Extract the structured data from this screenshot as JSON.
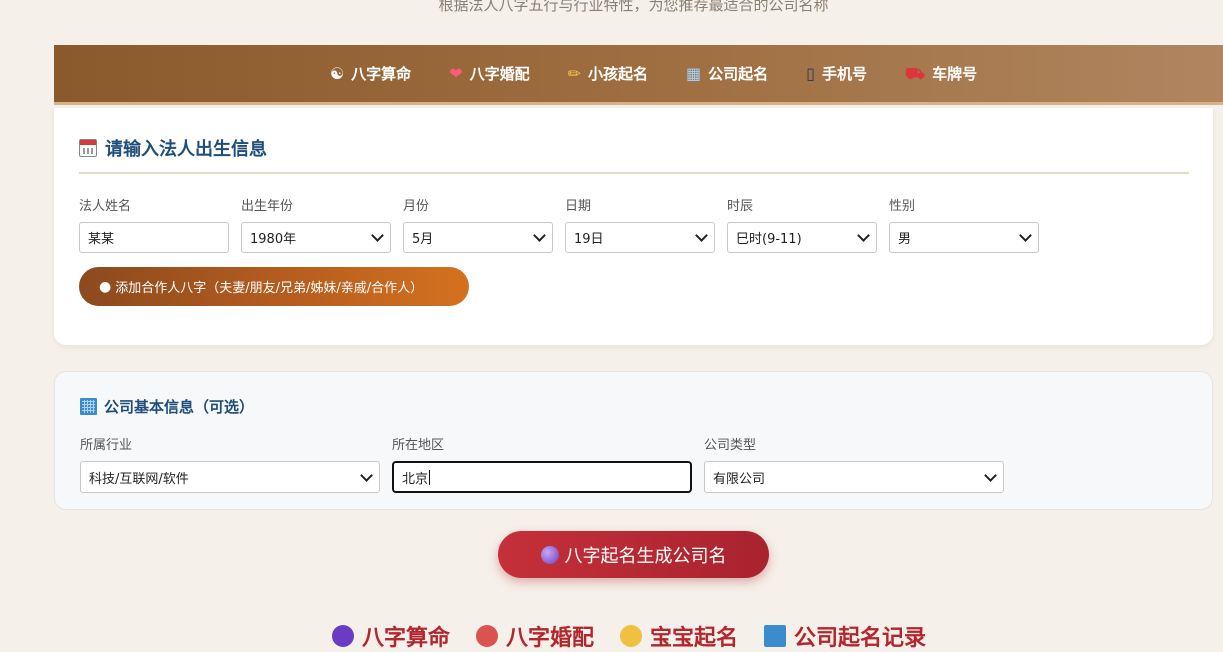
{
  "header": {
    "subtitle": "根据法人八字五行与行业特性，为您推荐最适合的公司名称"
  },
  "nav": {
    "items": [
      {
        "icon": "yin-yang-icon",
        "glyph": "☯",
        "label": "八字算命"
      },
      {
        "icon": "heart-icon",
        "glyph": "❤",
        "label": "八字婚配"
      },
      {
        "icon": "pencil-icon",
        "glyph": "✏",
        "label": "小孩起名"
      },
      {
        "icon": "building-icon",
        "glyph": "▦",
        "label": "公司起名"
      },
      {
        "icon": "phone-icon",
        "glyph": "▯",
        "label": "手机号"
      },
      {
        "icon": "car-icon",
        "glyph": "⛟",
        "label": "车牌号"
      }
    ]
  },
  "birth_form": {
    "title": "请输入法人出生信息",
    "fields": {
      "name": {
        "label": "法人姓名",
        "value": "某某"
      },
      "year": {
        "label": "出生年份",
        "value": "1980年"
      },
      "month": {
        "label": "月份",
        "value": "5月"
      },
      "day": {
        "label": "日期",
        "value": "19日"
      },
      "hour": {
        "label": "时辰",
        "value": "巳时(9-11)"
      },
      "gender": {
        "label": "性别",
        "value": "男"
      }
    },
    "add_partner_label": "添加合作人八字（夫妻/朋友/兄弟/姊妹/亲戚/合作人）"
  },
  "company_form": {
    "title": "公司基本信息（可选）",
    "fields": {
      "industry": {
        "label": "所属行业",
        "value": "科技/互联网/软件"
      },
      "region": {
        "label": "所在地区",
        "value": "北京"
      },
      "type": {
        "label": "公司类型",
        "value": "有限公司"
      }
    }
  },
  "generate_label": "八字起名生成公司名",
  "bottom_nav": {
    "items": [
      {
        "icon": "crystal-ball-icon",
        "label": "八字算命",
        "color": "#6a3cc4"
      },
      {
        "icon": "couple-icon",
        "label": "八字婚配",
        "color": "#d9534f"
      },
      {
        "icon": "baby-icon",
        "label": "宝宝起名",
        "color": "#f0c040"
      },
      {
        "icon": "building-icon",
        "label": "公司起名记录",
        "color": "#3a8ccc"
      }
    ]
  },
  "colors": {
    "nav_start": "#8a5a2c",
    "nav_end": "#b08560",
    "title_blue": "#1f4e79",
    "generate_red": "#c5303a",
    "add_btn_orange": "#d4711f"
  }
}
